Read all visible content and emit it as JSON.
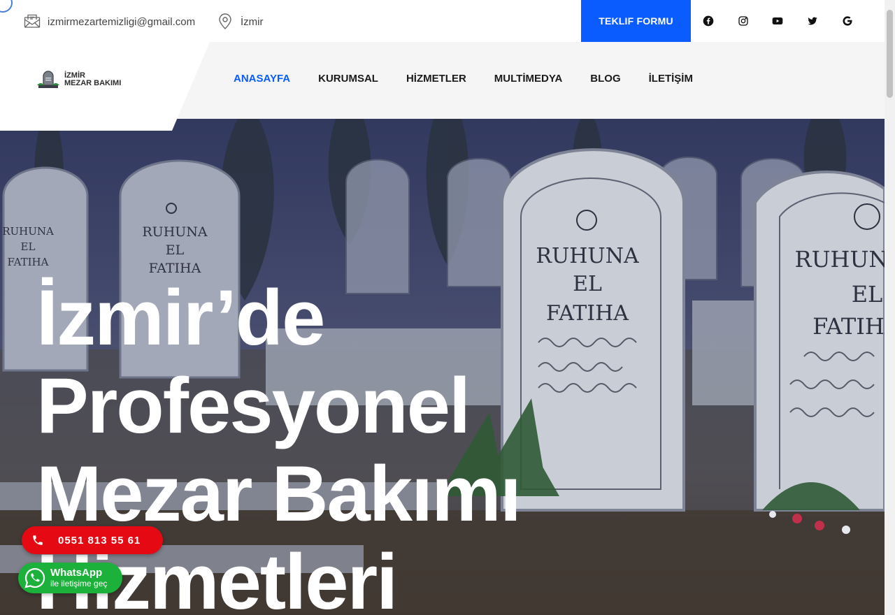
{
  "topbar": {
    "email": "izmirmezartemizligi@gmail.com",
    "location": "İzmir",
    "cta_label": "TEKLIF FORMU",
    "social": [
      {
        "icon": "facebook-icon"
      },
      {
        "icon": "instagram-icon"
      },
      {
        "icon": "youtube-icon"
      },
      {
        "icon": "twitter-icon"
      },
      {
        "icon": "google-icon"
      }
    ]
  },
  "logo": {
    "line1": "İZMİR",
    "line2": "MEZAR BAKIMI"
  },
  "nav": {
    "items": [
      {
        "label": "ANASAYFA",
        "active": true
      },
      {
        "label": "KURUMSAL",
        "active": false
      },
      {
        "label": "HİZMETLER",
        "active": false
      },
      {
        "label": "MULTİMEDYA",
        "active": false
      },
      {
        "label": "BLOG",
        "active": false
      },
      {
        "label": "İLETİŞİM",
        "active": false
      }
    ]
  },
  "hero": {
    "title_lines": [
      "İzmir’de",
      "Profesyonel",
      "Mezar Bakımı",
      "Hizmetleri"
    ],
    "stone_texts": [
      [
        "RUHUNA",
        "EL",
        "FATIHA"
      ],
      [
        "RUHUNA",
        "EL",
        "FATIHA"
      ],
      [
        "RUHUNA",
        "EL",
        "FATIHA"
      ],
      [
        "RUHUNA",
        "EL",
        "FATIHA"
      ]
    ]
  },
  "float": {
    "phone": "0551 813 55 61",
    "whatsapp_title": "WhatsApp",
    "whatsapp_sub": "ile iletişime geç"
  },
  "colors": {
    "accent": "#0a5cff",
    "phone_red": "#e50914",
    "whatsapp_green": "#1bb13a"
  }
}
